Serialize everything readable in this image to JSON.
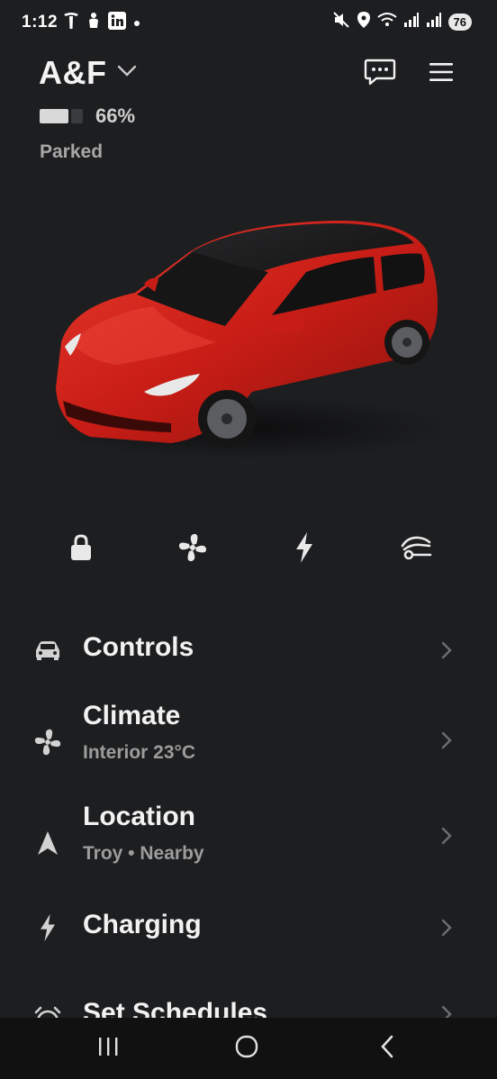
{
  "status_bar": {
    "time": "1:12",
    "battery_level": "76",
    "left_icons": [
      "tesla-icon",
      "hand-icon",
      "linkedin-icon",
      "dot-icon"
    ],
    "right_icons": [
      "mute-icon",
      "location-pin-icon",
      "wifi-icon",
      "signal-icon",
      "signal-icon"
    ]
  },
  "header": {
    "car_name": "A&F",
    "battery_percent": "66%",
    "battery_level": 0.66,
    "status": "Parked"
  },
  "quick_actions": [
    {
      "name": "lock",
      "icon": "lock-icon"
    },
    {
      "name": "climate",
      "icon": "fan-icon"
    },
    {
      "name": "charge",
      "icon": "bolt-icon"
    },
    {
      "name": "summon",
      "icon": "car-remote-icon"
    }
  ],
  "menu": {
    "items": [
      {
        "title": "Controls",
        "subtitle": "",
        "icon": "car-icon"
      },
      {
        "title": "Climate",
        "subtitle": "Interior 23°C",
        "icon": "fan-icon"
      },
      {
        "title": "Location",
        "subtitle": "Troy • Nearby",
        "icon": "navigation-arrow-icon"
      },
      {
        "title": "Charging",
        "subtitle": "",
        "icon": "bolt-icon"
      },
      {
        "title": "Set Schedules",
        "subtitle": "",
        "icon": "alarm-clock-icon"
      }
    ]
  },
  "colors": {
    "background": "#1d1e20",
    "car_body": "#d3241d",
    "text_primary": "#f2f2f2",
    "text_secondary": "#9c9c9c"
  }
}
